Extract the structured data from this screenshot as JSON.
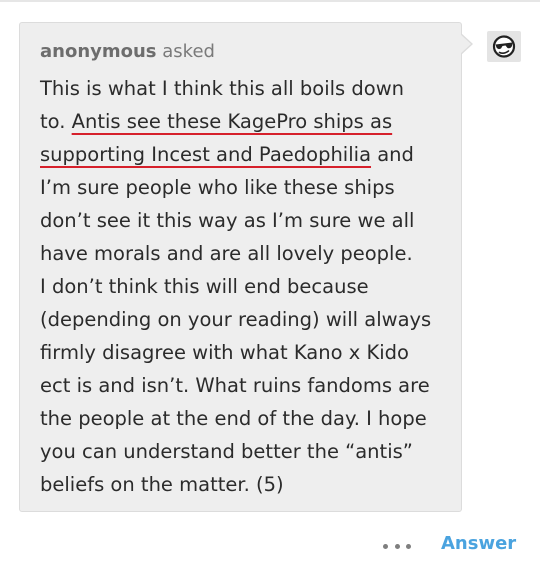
{
  "ask": {
    "asker_name": "anonymous",
    "asker_verb": "asked",
    "avatar_icon": "sunglasses-face-icon",
    "lines": [
      "This is what I think this all boils down",
      {
        "before": "to. ",
        "underlined": "Antis see these KagePro ships as"
      },
      {
        "underlined": "supporting Incest and Paedophilia",
        "after": " and"
      },
      "I’m sure people who like these ships",
      "don’t see it this way as I’m sure we all",
      "have morals and are all lovely people.",
      "I don’t think this will end because",
      "(depending on your reading) will always",
      "firmly disagree with what Kano x Kido",
      "ect is and isn’t. What ruins fandoms are",
      "the people at the end of the day. I hope",
      "you can understand better the “antis”",
      "beliefs on the matter. (5)"
    ]
  },
  "actions": {
    "more_icon": "more-dots-icon",
    "answer_label": "Answer"
  },
  "colors": {
    "bubble_bg": "#eeeeee",
    "underline": "#d6202b",
    "answer": "#4aa3df"
  }
}
